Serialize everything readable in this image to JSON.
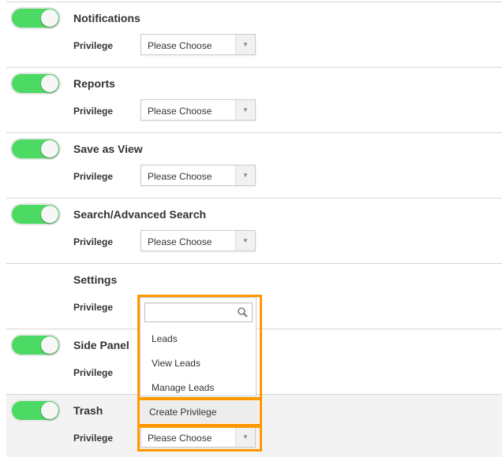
{
  "rows": [
    {
      "title": "Notifications",
      "toggle": true
    },
    {
      "title": "Reports",
      "toggle": true
    },
    {
      "title": "Save as View",
      "toggle": true
    },
    {
      "title": "Search/Advanced Search",
      "toggle": true
    },
    {
      "title": "Settings",
      "toggle": false
    },
    {
      "title": "Side Panel",
      "toggle": true
    },
    {
      "title": "Trash",
      "toggle": true
    }
  ],
  "privilege_label": "Privilege",
  "select_placeholder": "Please Choose",
  "dropdown": {
    "search_value": "",
    "options": [
      "Leads",
      "View Leads",
      "Manage Leads"
    ],
    "create_label": "Create Privilege"
  },
  "colors": {
    "toggle_on": "#4cd964",
    "highlight": "#ff9800"
  }
}
